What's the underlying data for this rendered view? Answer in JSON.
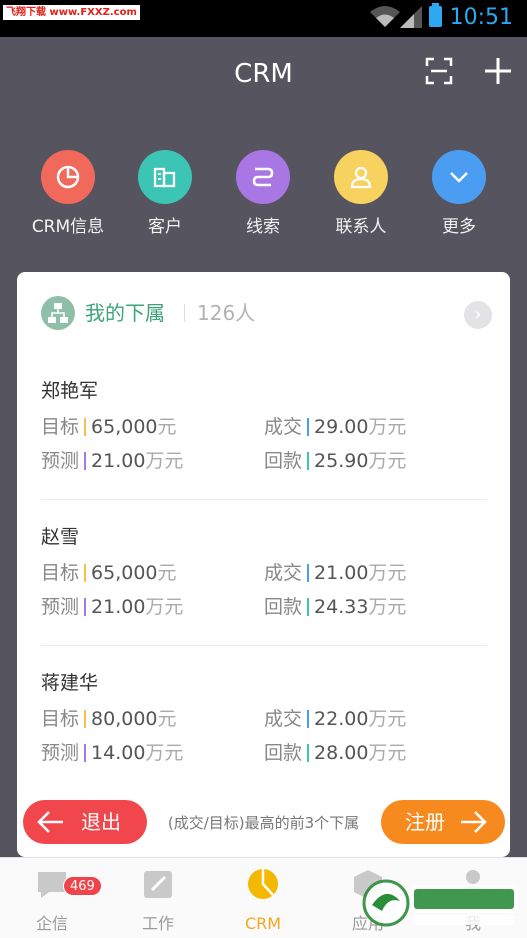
{
  "status": {
    "watermark": "飞翔下载 www.FXXZ.com",
    "time": "10:51"
  },
  "header": {
    "title": "CRM"
  },
  "categories": [
    {
      "label": "CRM信息",
      "icon": "pie-chart-icon",
      "color": "#f0695a"
    },
    {
      "label": "客户",
      "icon": "building-icon",
      "color": "#3cc4b5"
    },
    {
      "label": "线索",
      "icon": "route-icon",
      "color": "#a977e3"
    },
    {
      "label": "联系人",
      "icon": "person-icon",
      "color": "#f7d25f"
    },
    {
      "label": "更多",
      "icon": "chevron-down-icon",
      "color": "#4a9df0"
    }
  ],
  "card": {
    "title": "我的下属",
    "count": "126人",
    "labels": {
      "target": "目标",
      "forecast": "预测",
      "deal": "成交",
      "payment": "回款"
    },
    "people": [
      {
        "name": "郑艳军",
        "target": "65,000",
        "target_unit": "元",
        "forecast": "21.00",
        "forecast_unit": "万元",
        "deal": "29.00",
        "deal_unit": "万元",
        "payment": "25.90",
        "payment_unit": "万元"
      },
      {
        "name": "赵雪",
        "target": "65,000",
        "target_unit": "元",
        "forecast": "21.00",
        "forecast_unit": "万元",
        "deal": "21.00",
        "deal_unit": "万元",
        "payment": "24.33",
        "payment_unit": "万元"
      },
      {
        "name": "蒋建华",
        "target": "80,000",
        "target_unit": "元",
        "forecast": "14.00",
        "forecast_unit": "万元",
        "deal": "22.00",
        "deal_unit": "万元",
        "payment": "28.00",
        "payment_unit": "万元"
      }
    ],
    "footnote": "(成交/目标)最高的前3个下属"
  },
  "buttons": {
    "exit": "退出",
    "register": "注册"
  },
  "tabs": [
    {
      "label": "企信",
      "badge": "469"
    },
    {
      "label": "工作"
    },
    {
      "label": "CRM"
    },
    {
      "label": "应用"
    },
    {
      "label": "我"
    }
  ],
  "colors": {
    "accent_green": "#3ea47a",
    "active_tab": "#f5a623"
  }
}
